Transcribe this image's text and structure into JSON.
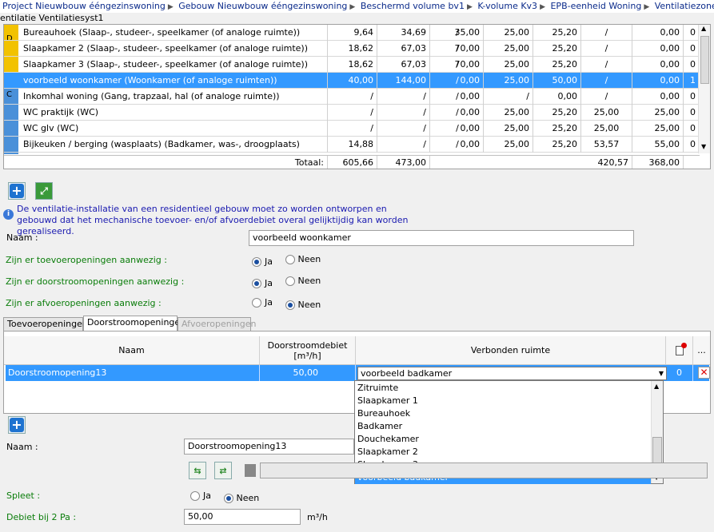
{
  "breadcrumb": [
    "Project Nieuwbouw ééngezinswoning",
    "Gebouw Nieuwbouw ééngezinswoning",
    "Beschermd volume bv1",
    "K-volume Kv3",
    "EPB-eenheid Woning",
    "Ventilatiezone vz1"
  ],
  "subtitle": "entilatie Ventilatiesyst1",
  "grid": {
    "rows": [
      {
        "name": "Bureauhoek (Slaap-, studeer-, speelkamer (of analoge ruimte))",
        "c1": "9,64",
        "c2": "34,69",
        "c3": "35,00",
        "c4": "/",
        "c5": "25,00",
        "c6": "25,20",
        "c7": "/",
        "c8": "0,00",
        "c9": "0"
      },
      {
        "name": "Slaapkamer 2 (Slaap-, studeer-, speelkamer (of analoge ruimte))",
        "c1": "18,62",
        "c2": "67,03",
        "c3": "70,00",
        "c4": "/",
        "c5": "25,00",
        "c6": "25,20",
        "c7": "/",
        "c8": "0,00",
        "c9": "0"
      },
      {
        "name": "Slaapkamer 3 (Slaap-, studeer-, speelkamer (of analoge ruimte))",
        "c1": "18,62",
        "c2": "67,03",
        "c3": "70,00",
        "c4": "/",
        "c5": "25,00",
        "c6": "25,20",
        "c7": "/",
        "c8": "0,00",
        "c9": "0"
      },
      {
        "name": "voorbeeld woonkamer (Woonkamer (of analoge ruimten))",
        "c1": "40,00",
        "c2": "144,00",
        "c3": "0,00",
        "c4": "/",
        "c5": "25,00",
        "c6": "50,00",
        "c7": "/",
        "c8": "0,00",
        "c9": "1"
      },
      {
        "name": "Inkomhal woning (Gang, trapzaal, hal (of analoge ruimte))",
        "c1": "/",
        "c2": "/",
        "c3": "0,00",
        "c4": "/",
        "c5": "/",
        "c6": "0,00",
        "c7": "/",
        "c8": "0,00",
        "c9": "0"
      },
      {
        "name": "WC praktijk (WC)",
        "c1": "/",
        "c2": "/",
        "c3": "0,00",
        "c4": "/",
        "c5": "25,00",
        "c6": "25,20",
        "c7": "25,00",
        "c8": "25,00",
        "c9": "0"
      },
      {
        "name": "WC glv  (WC)",
        "c1": "/",
        "c2": "/",
        "c3": "0,00",
        "c4": "/",
        "c5": "25,00",
        "c6": "25,20",
        "c7": "25,00",
        "c8": "25,00",
        "c9": "0"
      },
      {
        "name": "Bijkeuken / berging (wasplaats) (Badkamer, was-, droogplaats)",
        "c1": "14,88",
        "c2": "/",
        "c3": "0,00",
        "c4": "/",
        "c5": "25,00",
        "c6": "25,20",
        "c7": "53,57",
        "c8": "55,00",
        "c9": "0"
      }
    ],
    "side_labels": [
      "D",
      "C"
    ],
    "total_label": "Totaal:",
    "totals": {
      "c2": "605,66",
      "c3": "473,00",
      "c7": "420,57",
      "c8": "368,00"
    },
    "colors": {
      "side_d": "#f2c200",
      "side_c": "#4a90d9",
      "selected": "#3399ff"
    }
  },
  "info_text": "De ventilatie-installatie van een residentieel gebouw moet zo worden ontworpen en gebouwd dat het mechanische toevoer- en/of afvoerdebiet overal gelijktijdig kan worden gerealiseerd.",
  "form": {
    "naam_label": "Naam :",
    "naam_value": "voorbeeld woonkamer",
    "q1": "Zijn er toevoeropeningen aanwezig :",
    "q2": "Zijn er doorstroomopeningen aanwezig :",
    "q3": "Zijn er afvoeropeningen aanwezig :",
    "ja": "Ja",
    "neen": "Neen"
  },
  "tabs": [
    "Toevoeropeningen",
    "Doorstroomopeningen",
    "Afvoeropeningen"
  ],
  "subgrid": {
    "headers": {
      "naam": "Naam",
      "debiet": "Doorstroomdebiet [m³/h]",
      "verbonden": "Verbonden ruimte",
      "more": "..."
    },
    "row": {
      "naam": "Doorstroomopening13",
      "debiet": "50,00",
      "verbonden": "voorbeeld badkamer",
      "count": "0"
    }
  },
  "dropdown": [
    "Zitruimte",
    "Slaapkamer 1",
    "Bureauhoek",
    "Badkamer",
    "Douchekamer",
    "Slaapkamer 2",
    "Slaapkamer 3",
    "voorbeeld badkamer"
  ],
  "detail": {
    "naam_label": "Naam :",
    "naam_value": "Doorstroomopening13",
    "spleet_label": "Spleet :",
    "debiet_label": "Debiet bij 2 Pa :",
    "debiet_value": "50,00",
    "unit": "m³/h",
    "ja": "Ja",
    "neen": "Neen"
  }
}
